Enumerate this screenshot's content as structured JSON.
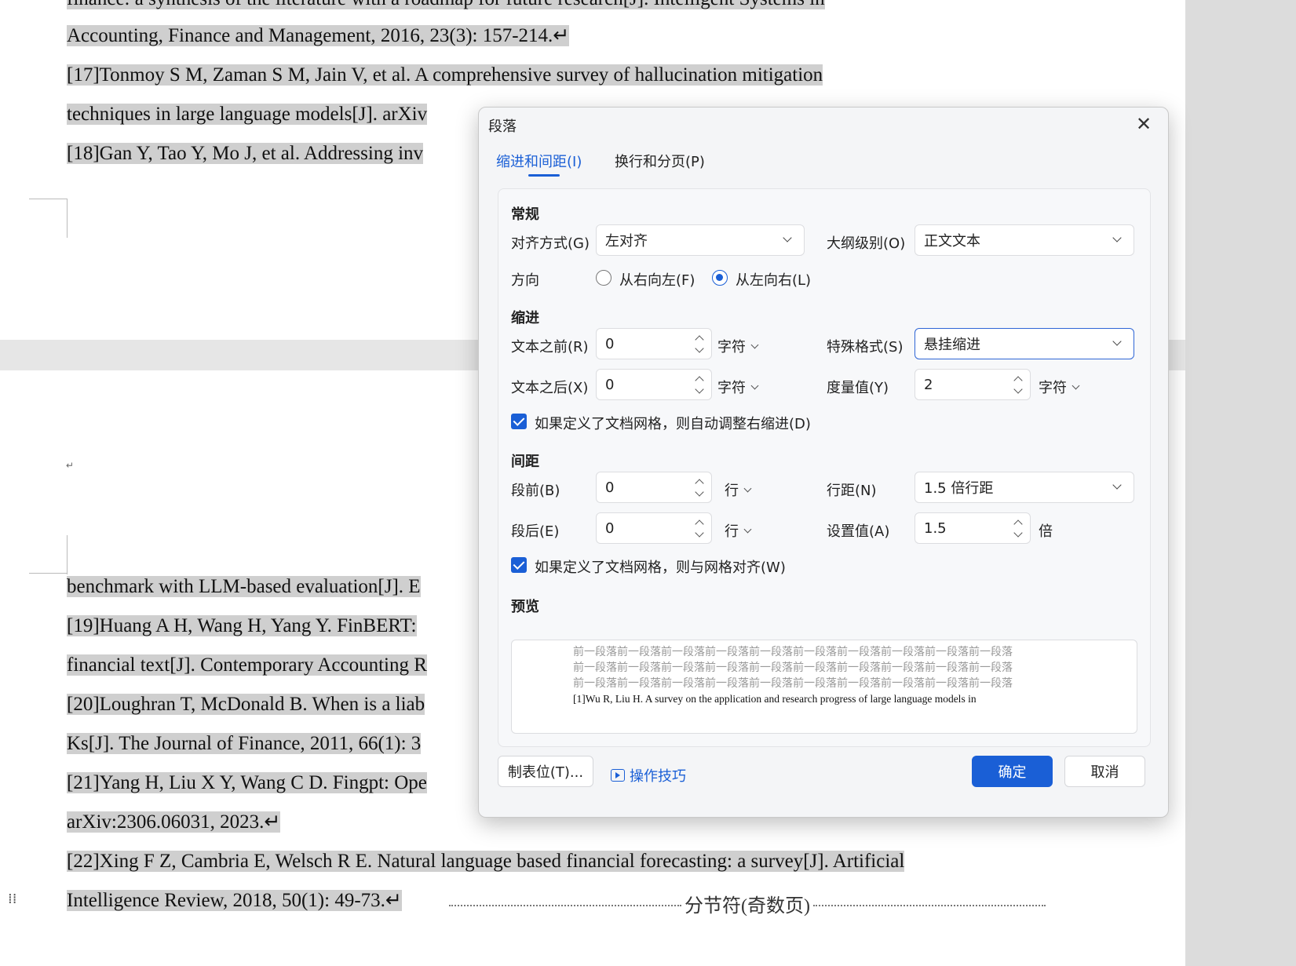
{
  "document": {
    "lines_top": [
      "finance: a synthesis of the literature with a roadmap for future research[J]. Intelligent Systems in",
      "Accounting, Finance and Management, 2016, 23(3): 157-214.↵",
      "[17]Tonmoy S M, Zaman S M, Jain V, et al. A comprehensive survey of hallucination mitigation",
      "techniques in large language models[J]. arXiv",
      "[18]Gan Y, Tao Y, Mo J, et al. Addressing inv"
    ],
    "paragraph_mark": "↵",
    "lines_bottom": [
      "benchmark with LLM-based evaluation[J]. E",
      "[19]Huang A H, Wang H, Yang Y. FinBERT: ",
      "financial text[J]. Contemporary Accounting R",
      "[20]Loughran T, McDonald B. When is a liab",
      "Ks[J]. The Journal of Finance, 2011, 66(1): 3",
      "[21]Yang H, Liu X Y, Wang C D. Fingpt: Ope",
      "arXiv:2306.06031, 2023.↵",
      "[22]Xing F Z, Cambria E, Welsch R E. Natural language based financial forecasting: a survey[J]. Artificial",
      "Intelligence Review, 2018, 50(1): 49-73.↵"
    ],
    "section_break": "分节符(奇数页)"
  },
  "dialog": {
    "title": "段落",
    "tabs": [
      {
        "label": "缩进和间距(I)",
        "active": true
      },
      {
        "label": "换行和分页(P)",
        "active": false
      }
    ],
    "general": {
      "heading": "常规",
      "alignment_label": "对齐方式(G)",
      "alignment_value": "左对齐",
      "outline_label": "大纲级别(O)",
      "outline_value": "正文文本",
      "direction_label": "方向",
      "rtl_label": "从右向左(F)",
      "ltr_label": "从左向右(L)",
      "direction_selected": "ltr"
    },
    "indent": {
      "heading": "缩进",
      "before_label": "文本之前(R)",
      "before_value": "0",
      "before_unit": "字符",
      "after_label": "文本之后(X)",
      "after_value": "0",
      "after_unit": "字符",
      "special_label": "特殊格式(S)",
      "special_value": "悬挂缩进",
      "measure_label": "度量值(Y)",
      "measure_value": "2",
      "measure_unit": "字符",
      "auto_adjust_label": "如果定义了文档网格，则自动调整右缩进(D)",
      "auto_adjust_checked": true
    },
    "spacing": {
      "heading": "间距",
      "before_label": "段前(B)",
      "before_value": "0",
      "before_unit": "行",
      "after_label": "段后(E)",
      "after_value": "0",
      "after_unit": "行",
      "line_spacing_label": "行距(N)",
      "line_spacing_value": "1.5 倍行距",
      "set_value_label": "设置值(A)",
      "set_value": "1.5",
      "set_value_unit": "倍",
      "snap_grid_label": "如果定义了文档网格，则与网格对齐(W)",
      "snap_grid_checked": true
    },
    "preview": {
      "heading": "预览",
      "prev_lines": [
        "前一段落前一段落前一段落前一段落前一段落前一段落前一段落前一段落前一段落前一段落",
        "前一段落前一段落前一段落前一段落前一段落前一段落前一段落前一段落前一段落前一段落",
        "前一段落前一段落前一段落前一段落前一段落前一段落前一段落前一段落前一段落前一段落"
      ],
      "current_line": "[1]Wu R, Liu H. A survey on the application and research progress of large language models in"
    },
    "buttons": {
      "tabs": "制表位(T)...",
      "tips": "操作技巧",
      "ok": "确定",
      "cancel": "取消"
    },
    "colors": {
      "accent": "#1a5fd6",
      "selection": "#cfcfcf"
    }
  }
}
